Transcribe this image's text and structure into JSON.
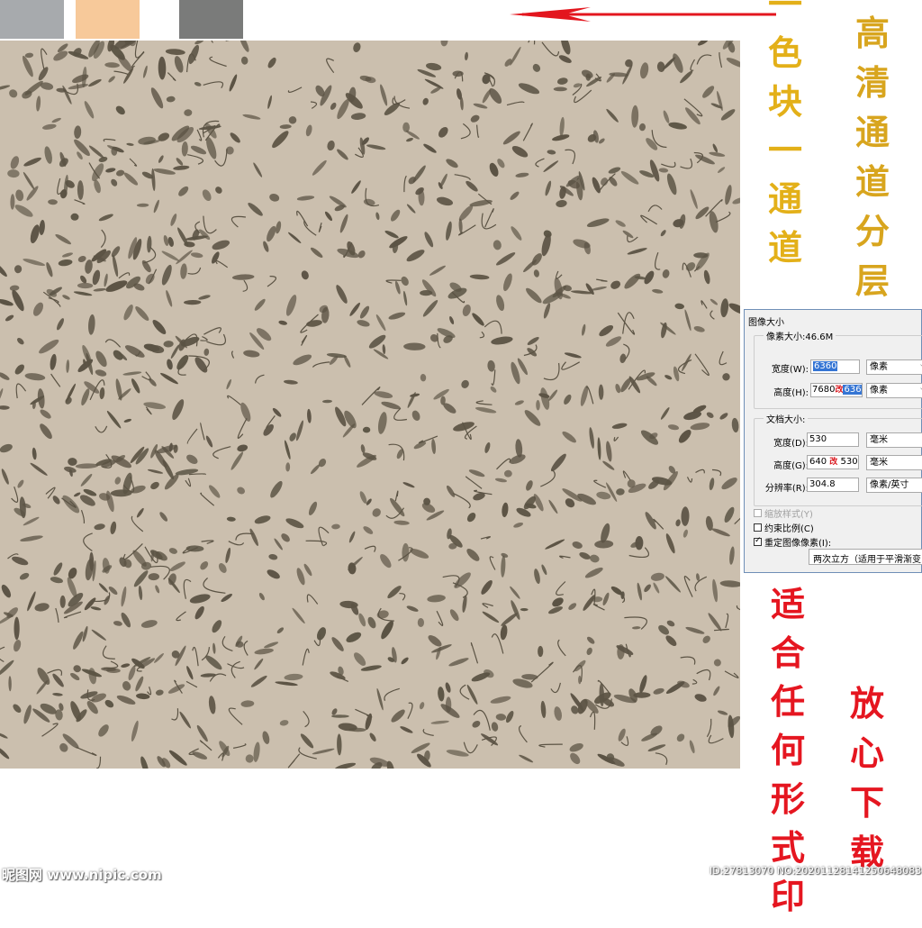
{
  "colors": {
    "swatches": [
      "#a7aaad",
      "#f7c99a",
      "#7a7b7a"
    ],
    "arrow": "#e3161e",
    "pattern_base": "#cbbfae",
    "pattern_leaf": "#5b5344",
    "annotation_gold": "#e3b019",
    "annotation_red": "#e51620"
  },
  "annotations": {
    "left_gold": [
      "一",
      "色",
      "块",
      "一",
      "通",
      "道"
    ],
    "right_gold": [
      "高",
      "清",
      "通",
      "道",
      "分",
      "层"
    ],
    "red_left": [
      "适",
      "合",
      "任",
      "何",
      "形",
      "式",
      "印"
    ],
    "red_right": [
      "放",
      "心",
      "下",
      "载"
    ]
  },
  "dialog": {
    "title": "图像大小",
    "pixel_dimensions": {
      "label": "像素大小:46.6M",
      "width_label": "宽度(W):",
      "width_value": "6360",
      "width_unit": "像素",
      "height_label": "高度(H):",
      "height_value": "7680",
      "height_annot": "改",
      "height_new": "6360",
      "height_unit": "像素"
    },
    "document_size": {
      "label": "文档大小:",
      "width_label": "宽度(D):",
      "width_value": "530",
      "width_unit": "毫米",
      "height_label": "高度(G):",
      "height_value": "640",
      "height_annot": "改",
      "height_new": "530",
      "height_unit": "毫米",
      "resolution_label": "分辨率(R):",
      "resolution_value": "304.8",
      "resolution_unit": "像素/英寸"
    },
    "checkboxes": {
      "scale_styles": "缩放样式(Y)",
      "constrain": "约束比例(C)",
      "resample": "重定图像像素(I):"
    },
    "resample_method": "两次立方（适用于平滑渐变"
  },
  "watermarks": {
    "left": "昵图网 www.nipic.com",
    "right": "ID:27813070 NO:20201128141250648083"
  }
}
